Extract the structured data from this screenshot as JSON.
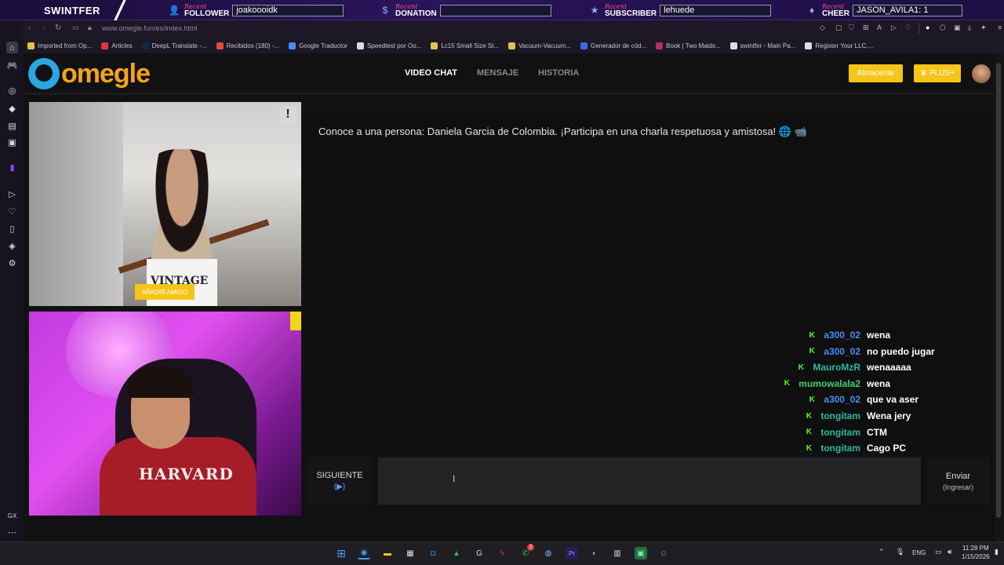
{
  "overlay": {
    "brand": "SWINTFER",
    "recent_label": "Recent",
    "follower": {
      "type": "FOLLOWER",
      "value": "joakoooidk"
    },
    "donation": {
      "type": "DONATION",
      "value": ""
    },
    "subscriber": {
      "type": "SUBSCRIBER",
      "value": "lehuede"
    },
    "cheer": {
      "type": "CHEER",
      "value": "JASON_AVILA1: 1"
    }
  },
  "browser": {
    "url": "www.omegle.fun/es/index.html",
    "bookmarks": [
      {
        "label": "Imported from Op...",
        "color": "#e8c04a"
      },
      {
        "label": "Articles",
        "color": "#d43c3c"
      },
      {
        "label": "DeepL Translate -...",
        "color": "#0f2b46"
      },
      {
        "label": "Recibidos (180) -...",
        "color": "#e44b3a"
      },
      {
        "label": "Google Traductor",
        "color": "#4a8af4"
      },
      {
        "label": "Speedtest por Oo...",
        "color": "#ddd"
      },
      {
        "label": "Lc15 Small Size St...",
        "color": "#e8c04a"
      },
      {
        "label": "Vacuum-Vacuum...",
        "color": "#e8c04a"
      },
      {
        "label": "Generador de cód...",
        "color": "#3a6ae8"
      },
      {
        "label": "Book | Two Maids...",
        "color": "#b03060"
      },
      {
        "label": "swintfer - Main Pa...",
        "color": "#ddd"
      },
      {
        "label": "Register Your LLC,...",
        "color": "#ddd"
      }
    ]
  },
  "site": {
    "logo_text": "omegle",
    "nav": [
      "VIDEO CHAT",
      "MENSAJE",
      "HISTORIA"
    ],
    "store_label": "Almacenar",
    "plus_label": "PLUS+"
  },
  "video": {
    "add_friend_label": "AÑADIR AMIGO",
    "report_label": "!",
    "shirt_text": "VINTAGE",
    "hoodie_text": "HARVARD"
  },
  "chat": {
    "intro": "Conoce a una persona: Daniela Garcia de Colombia. ¡Participa en una charla respetuosa y amistosa! 🌐 📹",
    "messages": [
      {
        "user": "a300_02",
        "text": "wena",
        "color": "#4a8af4"
      },
      {
        "user": "a300_02",
        "text": "no puedo jugar",
        "color": "#4a8af4"
      },
      {
        "user": "MauroMzR",
        "text": "wenaaaaa",
        "color": "#2eb8a0"
      },
      {
        "user": "mumowalala2",
        "text": "wena",
        "color": "#3fd06a"
      },
      {
        "user": "a300_02",
        "text": "que va aser",
        "color": "#4a8af4"
      },
      {
        "user": "tongitam",
        "text": "Wena jery",
        "color": "#2eb8a0"
      },
      {
        "user": "tongitam",
        "text": "CTM",
        "color": "#2eb8a0"
      },
      {
        "user": "tongitam",
        "text": "Cago PC",
        "color": "#2eb8a0"
      }
    ],
    "next_label": "SIGUIENTE",
    "next_sub": "(▶)",
    "send_label": "Enviar",
    "send_sub": "(Ingresar)",
    "input_value": ""
  },
  "taskbar": {
    "lang": "ENG",
    "time": "11:28 PM",
    "date": "1/15/2026",
    "whatsapp_badge": "2"
  }
}
